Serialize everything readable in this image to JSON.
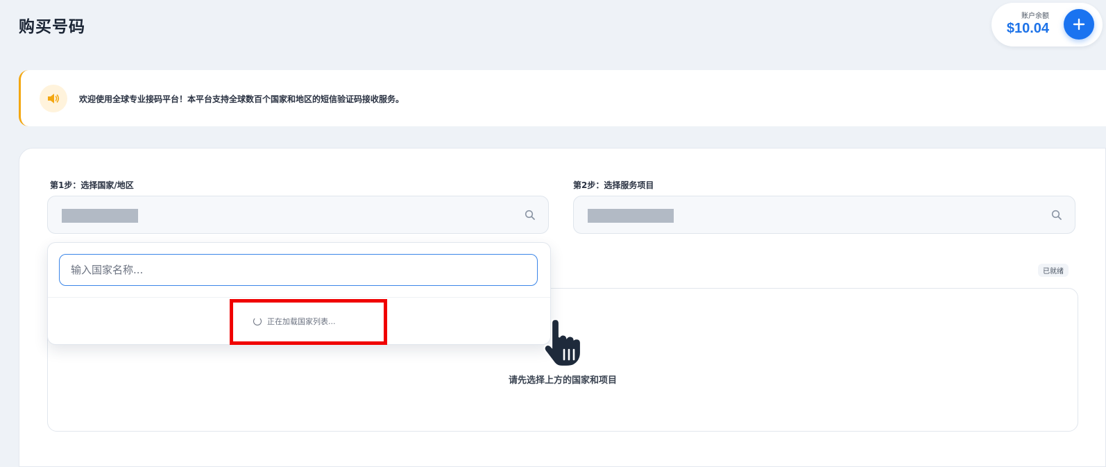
{
  "header": {
    "title": "购买号码",
    "balance_label": "账户余额",
    "balance_value": "$10.04",
    "add_button_icon": "plus-icon"
  },
  "notice": {
    "icon": "speaker-icon",
    "text": "欢迎使用全球专业接码平台！本平台支持全球数百个国家和地区的短信验证码接收服务。",
    "accent_color": "#f3a712"
  },
  "steps": {
    "step1_label": "第1步：选择国家/地区",
    "step2_label": "第2步：选择服务项目"
  },
  "dropdown": {
    "search_placeholder": "输入国家名称...",
    "loading_text": "正在加载国家列表..."
  },
  "status": {
    "badge": "已就绪",
    "empty_message": "请先选择上方的国家和项目"
  },
  "colors": {
    "primary": "#1a73f0",
    "background": "#eef2f7",
    "highlight": "#f00000"
  }
}
